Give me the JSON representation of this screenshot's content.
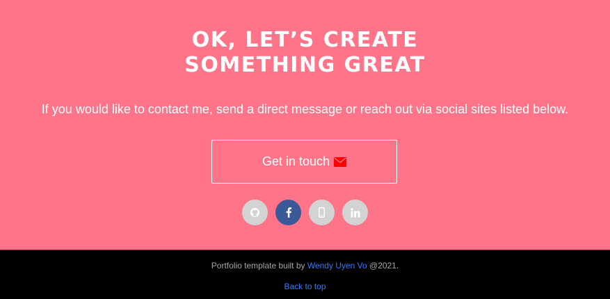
{
  "contact": {
    "headline_line1": "OK, LET’S CREATE",
    "headline_line2": "SOMETHING GREAT",
    "subtitle": "If you would like to contact me, send a direct message or reach out via social sites listed below.",
    "cta_label": "Get in touch",
    "cta_icon": "envelope-icon",
    "cta_icon_color": "#ff0000",
    "background_color": "#ff7489",
    "socials": [
      {
        "name": "github",
        "icon": "github-icon"
      },
      {
        "name": "facebook",
        "icon": "facebook-icon",
        "color": "#3b5998"
      },
      {
        "name": "phone",
        "icon": "mobile-phone-icon"
      },
      {
        "name": "linkedin",
        "icon": "linkedin-icon"
      }
    ]
  },
  "footer": {
    "credit_prefix": "Portfolio template built by ",
    "credit_author": "Wendy Uyen Vo",
    "credit_suffix": " @2021.",
    "back_to_top": "Back to top",
    "link_color": "#2a7bff"
  }
}
